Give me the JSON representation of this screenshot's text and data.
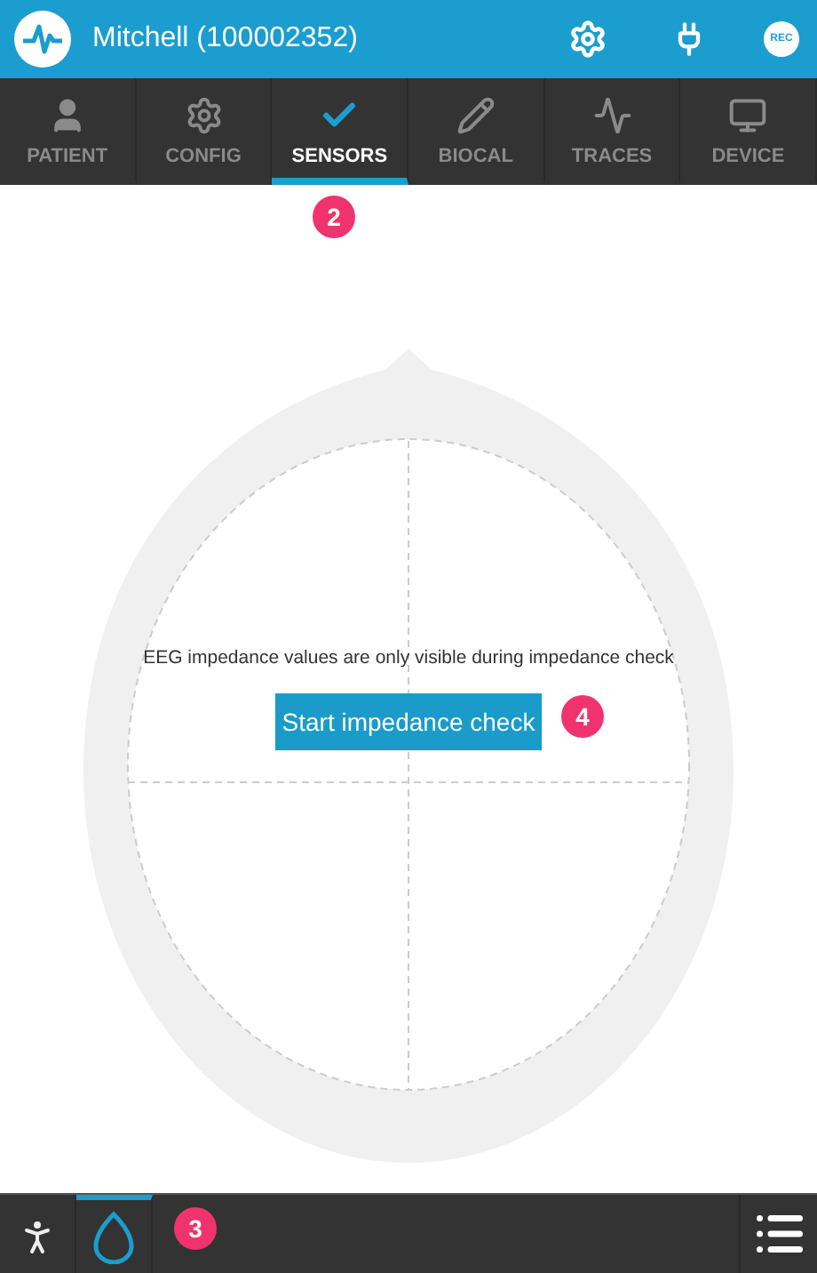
{
  "header": {
    "title": "Mitchell (100002352)",
    "rec_label": "REC"
  },
  "tabs": [
    {
      "label": "PATIENT",
      "kind": "user",
      "selected": false
    },
    {
      "label": "CONFIG",
      "kind": "gear",
      "selected": false
    },
    {
      "label": "SENSORS",
      "kind": "check",
      "selected": true
    },
    {
      "label": "BIOCAL",
      "kind": "pencil",
      "selected": false
    },
    {
      "label": "TRACES",
      "kind": "pulse",
      "selected": false
    },
    {
      "label": "DEVICE",
      "kind": "monitor",
      "selected": false
    }
  ],
  "content": {
    "message": "EEG impedance values are only visible during impedance check",
    "button": "Start impedance check"
  },
  "bottom_tabs": [
    {
      "kind": "body",
      "selected": false
    },
    {
      "kind": "head",
      "selected": true
    }
  ],
  "annotations": [
    "2",
    "3",
    "4"
  ]
}
